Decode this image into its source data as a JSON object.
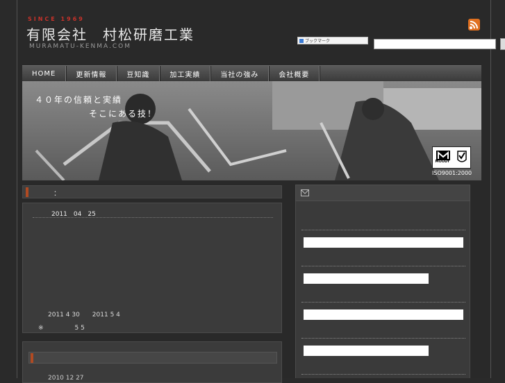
{
  "header": {
    "since": "SINCE 1969",
    "company": "有限会社　村松研磨工業",
    "domain": "MURAMATU-KENMA.COM",
    "bookmark_label": "ブックマーク",
    "search_value": ""
  },
  "nav": {
    "items": [
      {
        "label": "HOME"
      },
      {
        "label": "更新情報"
      },
      {
        "label": "豆知識"
      },
      {
        "label": "加工実績"
      },
      {
        "label": "当社の強み"
      },
      {
        "label": "会社概要"
      }
    ]
  },
  "hero": {
    "line1": "４０年の信頼と実績",
    "line2": "そこにある技！",
    "cert_brand": "MOODY",
    "cert_text": "ISO9001:2000"
  },
  "main": {
    "section_title": "：",
    "post": {
      "date": "2011　04　25",
      "range": "2011 4 30　　2011 5 4",
      "note": "※　　　　　5 5"
    },
    "post2": {
      "date": "2010 12 27"
    }
  },
  "icons": {
    "rss": "rss-icon",
    "mail": "mail-icon"
  },
  "colors": {
    "accent": "#b04a22",
    "rss": "#e07020"
  }
}
